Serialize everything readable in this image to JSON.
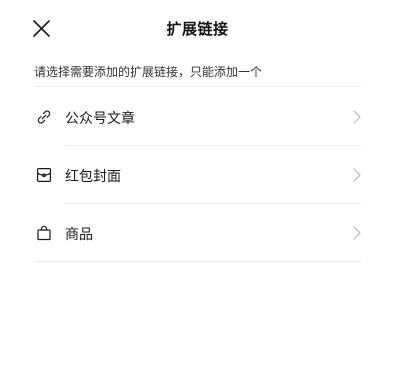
{
  "header": {
    "title": "扩展链接",
    "close_icon": "close-icon"
  },
  "hint": "请选择需要添加的扩展链接，只能添加一个",
  "items": [
    {
      "label": "公众号文章",
      "icon": "link-icon"
    },
    {
      "label": "红包封面",
      "icon": "red-packet-cover-icon"
    },
    {
      "label": "商品",
      "icon": "shopping-bag-icon"
    }
  ],
  "colors": {
    "text": "#1a1a1a",
    "divider": "#ededed",
    "chevron": "#b8b8b8"
  }
}
